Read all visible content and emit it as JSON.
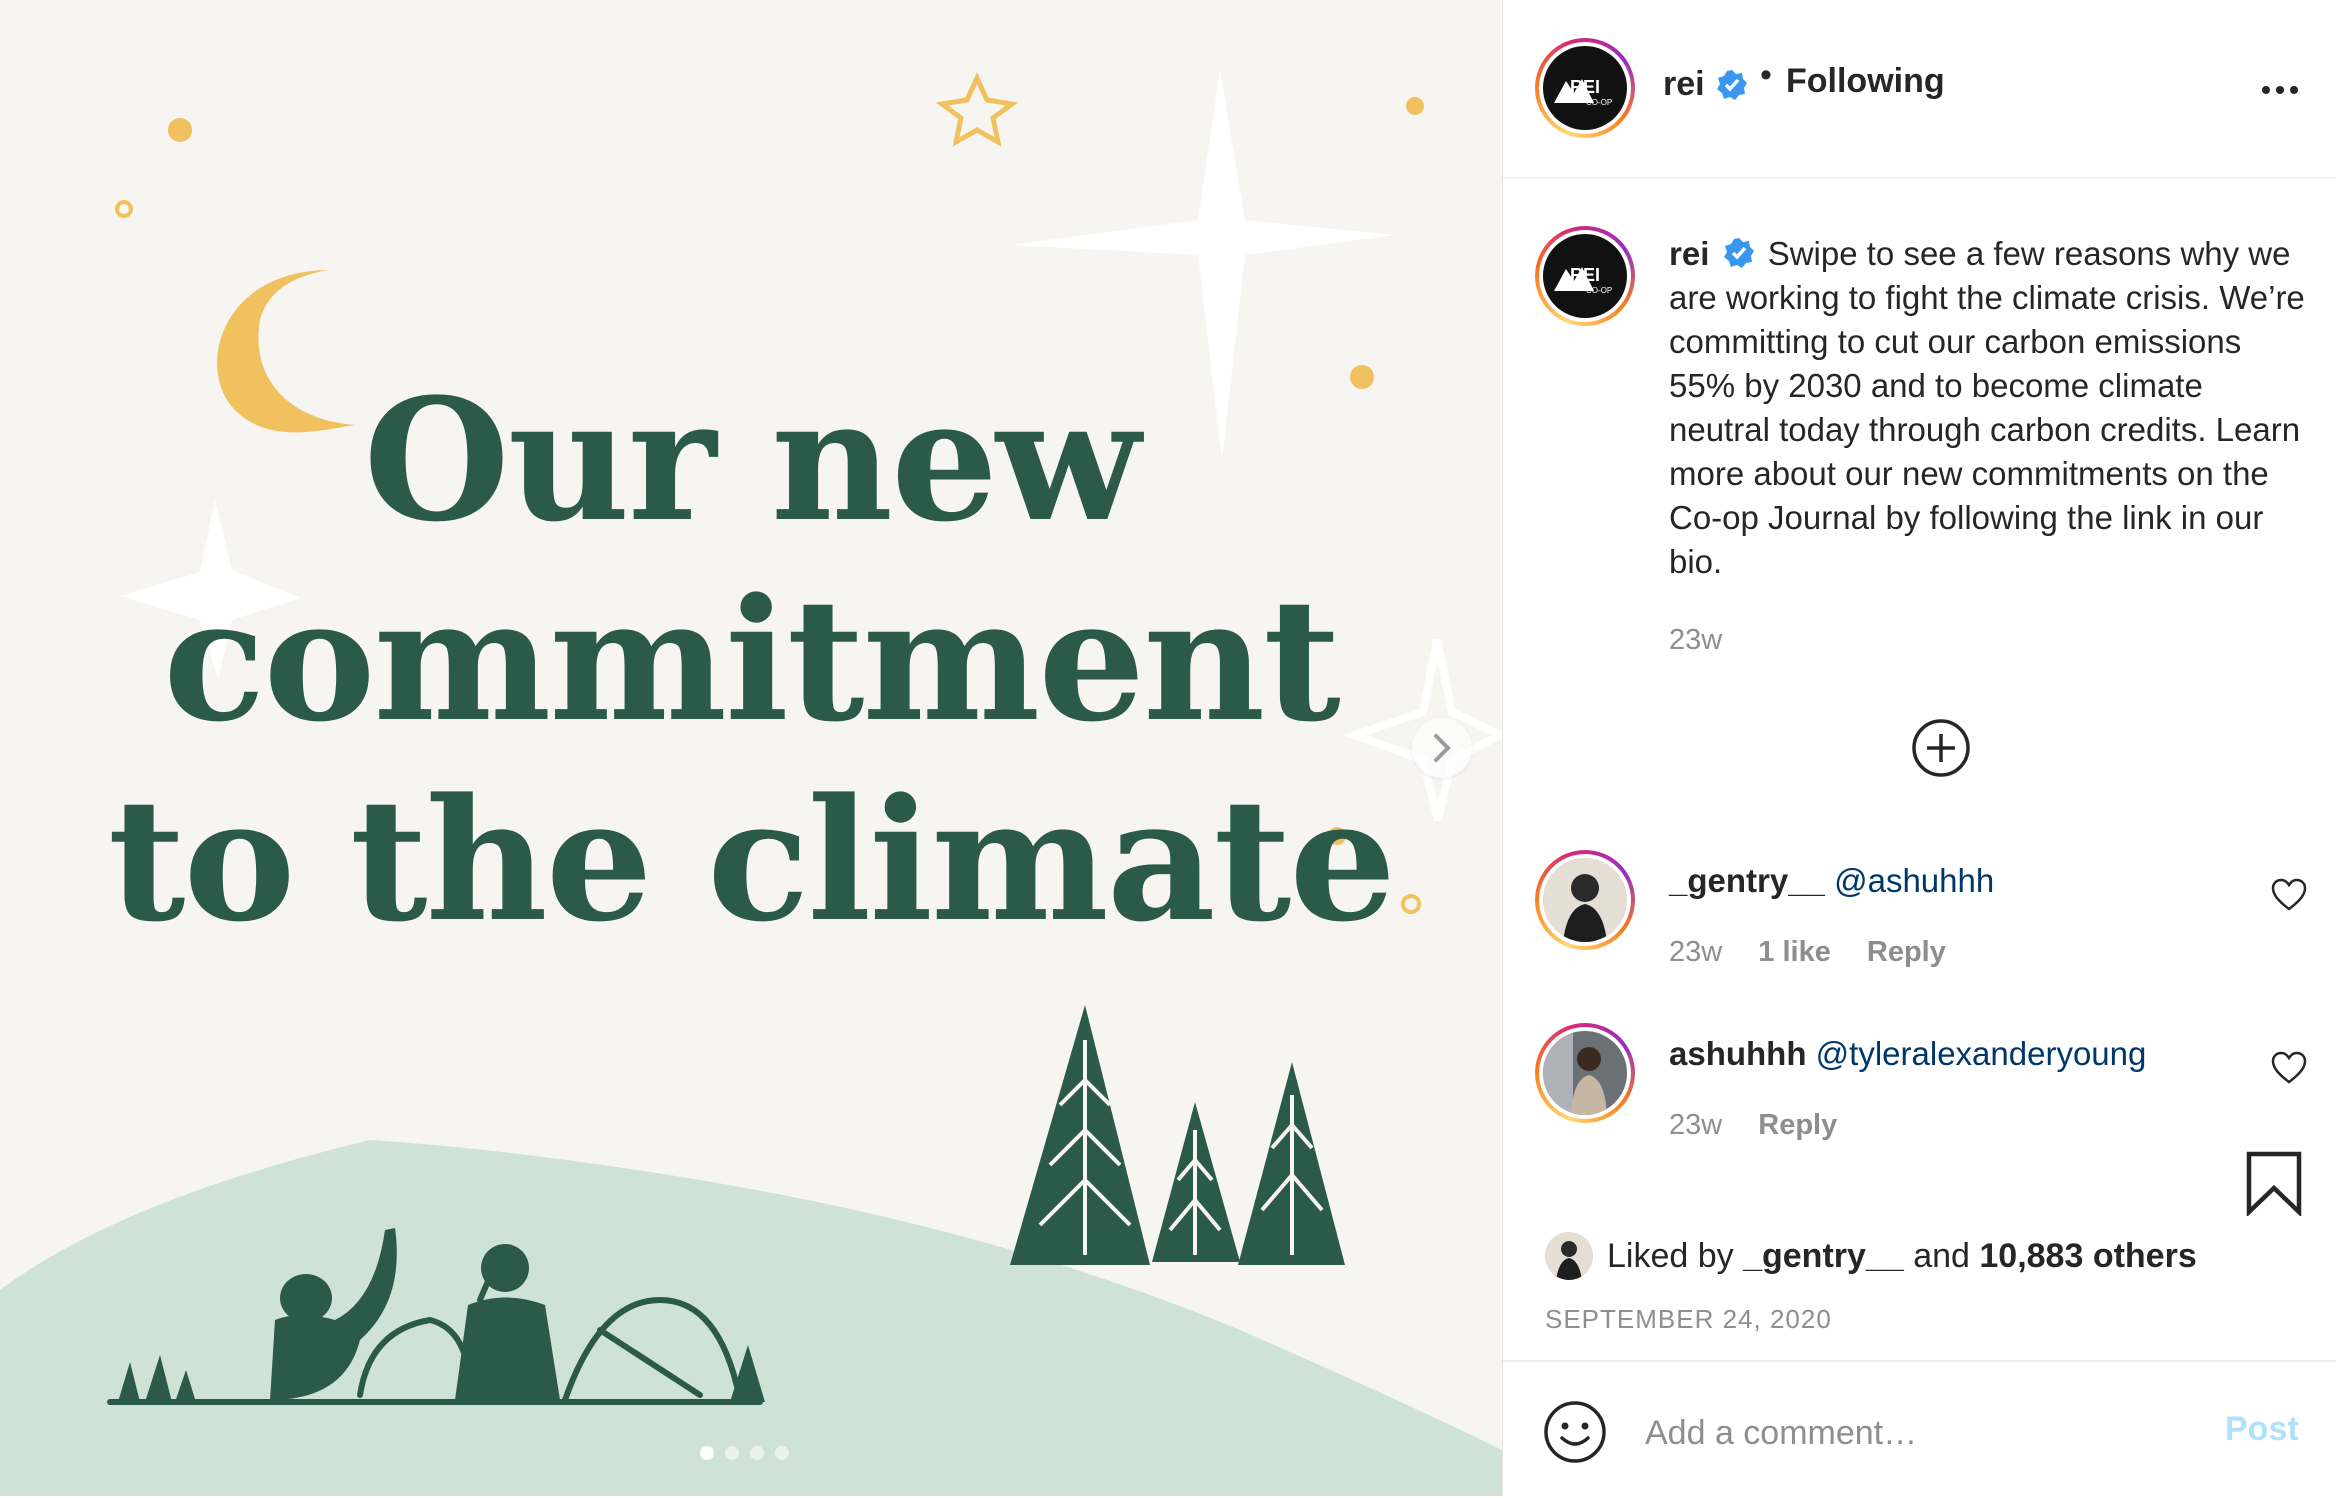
{
  "media": {
    "headline_lines": [
      "Our new",
      "commitment",
      "to the climate"
    ],
    "carousel_count": 4,
    "carousel_active_index": 0,
    "next_icon": "chevron-right-icon",
    "colors": {
      "background": "#f7f5f1",
      "text": "#2c5a4a",
      "hill": "#cfe2d7",
      "accent": "#f2c15f",
      "illustration": "#2c5a4a"
    }
  },
  "post": {
    "username": "rei",
    "avatar_logo_text": "REI",
    "avatar_logo_subtext": "CO-OP",
    "separator": "•",
    "follow_status": "Following",
    "more_icon": "more-horizontal-icon"
  },
  "caption": {
    "username": "rei",
    "text": "Swipe to see a few reasons why we are working to fight the climate crisis. We’re committing to cut our carbon emissions 55% by 2030 and to become climate neutral today through carbon credits. Learn more about our new commitments on the Co-op Journal by following the link in our bio.",
    "time": "23w"
  },
  "load_more_icon": "plus-circle-icon",
  "comments": [
    {
      "username": "_gentry__",
      "mention": "@ashuhhh",
      "time": "23w",
      "likes": "1 like",
      "reply": "Reply"
    },
    {
      "username": "ashuhhh",
      "mention": "@tyleralexanderyoung",
      "time": "23w",
      "likes": "",
      "reply": "Reply"
    }
  ],
  "likes": {
    "prefix": "Liked by",
    "user": "_gentry__",
    "connector": "and",
    "others": "10,883 others"
  },
  "date": "SEPTEMBER 24, 2020",
  "add_comment": {
    "placeholder": "Add a comment…",
    "post_label": "Post"
  },
  "colors": {
    "verified": "#3897f0",
    "link": "#00376b",
    "muted": "#8e8e8e",
    "post_disabled": "#b2dffc"
  }
}
